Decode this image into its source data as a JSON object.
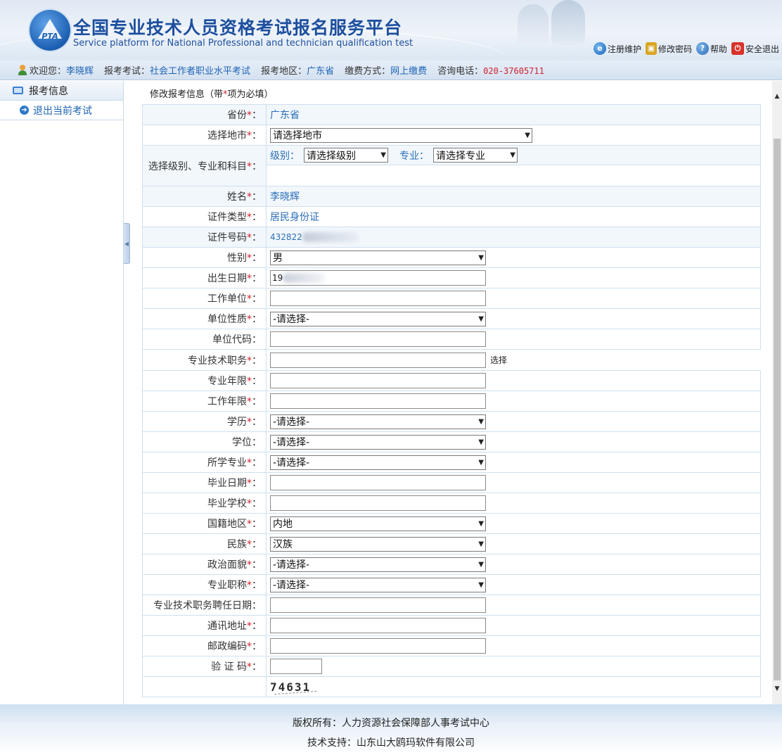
{
  "header": {
    "title": "全国专业技术人员资格考试报名服务平台",
    "subtitle": "Service platform for National Professional and technician qualification test",
    "logo_text": "PTA",
    "links": [
      {
        "label": "注册维护",
        "icon": "globe-icon"
      },
      {
        "label": "修改密码",
        "icon": "lock-icon"
      },
      {
        "label": "帮助",
        "icon": "help-icon"
      },
      {
        "label": "安全退出",
        "icon": "power-icon"
      }
    ]
  },
  "infobar": {
    "welcome_label": "欢迎您：",
    "user_name": "李晓辉",
    "exam_label": "报考考试：",
    "exam_value": "社会工作者职业水平考试",
    "region_label": "报考地区：",
    "region_value": "广东省",
    "pay_label": "缴费方式：",
    "pay_value": "网上缴费",
    "phone_label": "咨询电话：",
    "phone_value": "020-37605711"
  },
  "sidebar": {
    "header": "报考信息",
    "items": [
      {
        "label": "退出当前考试"
      }
    ]
  },
  "form": {
    "title_prefix": "修改报考信息（带",
    "title_star": "*",
    "title_suffix": "项为必填）",
    "province_label": "省份",
    "province_value": "广东省",
    "city_label": "选择地市",
    "city_value": "请选择地市",
    "level_row_label": "选择级别、专业和科目",
    "level_label": "级别：",
    "level_value": "请选择级别",
    "major_label": "专业：",
    "major_value": "请选择专业",
    "name_label": "姓名",
    "name_value": "李晓辉",
    "id_type_label": "证件类型",
    "id_type_value": "居民身份证",
    "id_no_label": "证件号码",
    "id_no_value": "432822",
    "gender_label": "性别",
    "gender_value": "男",
    "birth_label": "出生日期",
    "birth_value": "19",
    "employer_label": "工作单位",
    "employer_value": "",
    "unit_type_label": "单位性质",
    "unit_type_value": "-请选择-",
    "unit_code_label": "单位代码",
    "unit_code_value": "",
    "title_job_label": "专业技术职务",
    "title_job_value": "",
    "title_job_pick": "选择",
    "major_years_label": "专业年限",
    "major_years_value": "",
    "work_years_label": "工作年限",
    "work_years_value": "",
    "education_label": "学历",
    "education_value": "-请选择-",
    "degree_label": "学位",
    "degree_value": "-请选择-",
    "studied_major_label": "所学专业",
    "studied_major_value": "-请选择-",
    "grad_date_label": "毕业日期",
    "grad_date_value": "",
    "school_label": "毕业学校",
    "school_value": "",
    "nationality_label": "国籍地区",
    "nationality_value": "内地",
    "ethnic_label": "民族",
    "ethnic_value": "汉族",
    "politics_label": "政治面貌",
    "politics_value": "-请选择-",
    "pro_title_label": "专业职称",
    "pro_title_value": "-请选择-",
    "appoint_date_label": "专业技术职务聘任日期：",
    "appoint_date_value": "",
    "address_label": "通讯地址",
    "address_value": "",
    "postcode_label": "邮政编码",
    "postcode_value": "",
    "captcha_label": "验 证 码",
    "captcha_value": "",
    "captcha_image_text": "74631",
    "required_star": "*",
    "colon": "："
  },
  "footer": {
    "copyright": "版权所有：人力资源社会保障部人事考试中心",
    "support": "技术支持：山东山大鸥玛软件有限公司"
  },
  "colors": {
    "accent": "#1f64b4",
    "required": "#d0212b",
    "title": "#1d4f9e"
  }
}
